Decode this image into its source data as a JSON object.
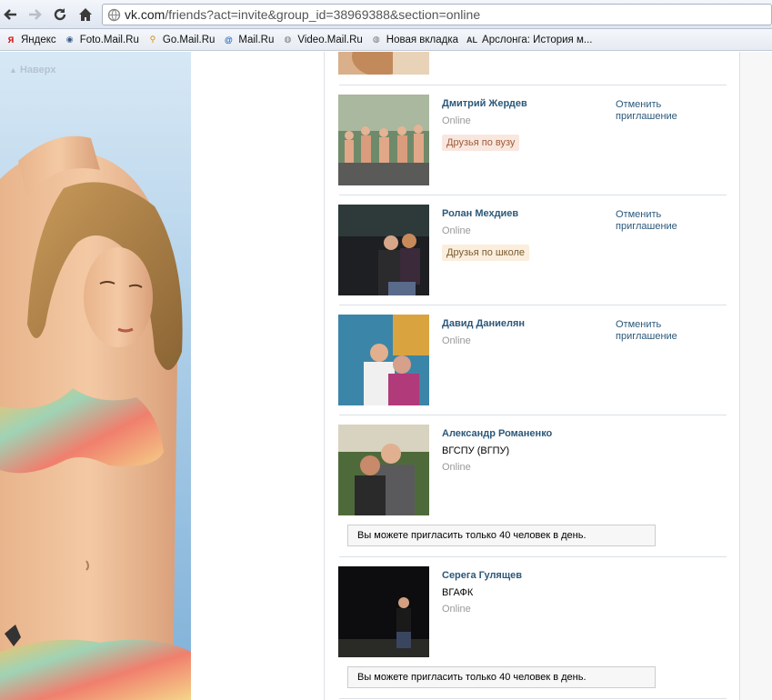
{
  "browser": {
    "url_host": "vk.com",
    "url_path": "/friends?act=invite&group_id=38969388&section=online"
  },
  "bookmarks": [
    {
      "label": "Яндекс",
      "icon": "yandex-icon",
      "glyph": "Я",
      "color": "#d40000"
    },
    {
      "label": "Foto.Mail.Ru",
      "icon": "camera-icon",
      "glyph": "◉",
      "color": "#3a5a8a"
    },
    {
      "label": "Go.Mail.Ru",
      "icon": "search-icon",
      "glyph": "⚲",
      "color": "#d48a00"
    },
    {
      "label": "Mail.Ru",
      "icon": "at-icon",
      "glyph": "@",
      "color": "#1a5fb4"
    },
    {
      "label": "Video.Mail.Ru",
      "icon": "globe-icon",
      "glyph": "◍",
      "color": "#777777"
    },
    {
      "label": "Новая вкладка",
      "icon": "globe-icon",
      "glyph": "◍",
      "color": "#777777"
    },
    {
      "label": "Арслонга: История м...",
      "icon": "al-logo-icon",
      "glyph": "AL",
      "color": "#333333"
    }
  ],
  "left": {
    "up_label": "Наверх"
  },
  "friends": [
    {
      "name": "Дмитрий Жердев",
      "status": "Online",
      "badge": "Друзья по вузу",
      "action": "Отменить приглашение"
    },
    {
      "name": "Ролан Мехдиев",
      "status": "Online",
      "badge": "Друзья по школе",
      "action": "Отменить приглашение"
    },
    {
      "name": "Давид Даниелян",
      "status": "Online",
      "action": "Отменить приглашение"
    },
    {
      "name": "Александр Романенко",
      "school": "ВГСПУ (ВГПУ)",
      "status": "Online",
      "notice": "Вы можете пригласить только 40 человек в день."
    },
    {
      "name": "Серега Гулящев",
      "school": "ВГАФК",
      "status": "Online",
      "notice": "Вы можете пригласить только 40 человек в день."
    }
  ]
}
